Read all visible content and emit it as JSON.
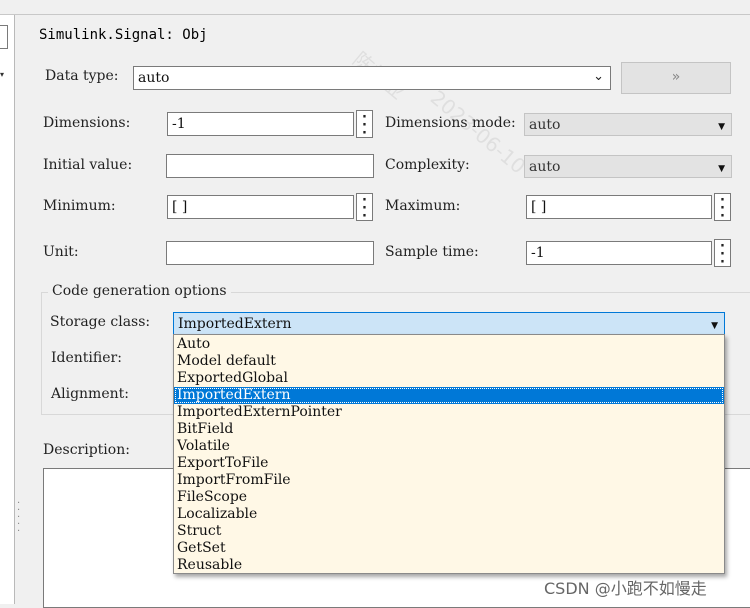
{
  "title": "Simulink.Signal: Obj",
  "data_type": {
    "label": "Data type:",
    "value": "auto",
    "advanced_button": "»"
  },
  "dimensions": {
    "label": "Dimensions:",
    "value": "-1"
  },
  "dimensions_mode": {
    "label": "Dimensions mode:",
    "value": "auto"
  },
  "initial_value": {
    "label": "Initial value:",
    "value": ""
  },
  "complexity": {
    "label": "Complexity:",
    "value": "auto"
  },
  "minimum": {
    "label": "Minimum:",
    "value": "[ ]"
  },
  "maximum": {
    "label": "Maximum:",
    "value": "[ ]"
  },
  "unit": {
    "label": "Unit:",
    "value": ""
  },
  "sample_time": {
    "label": "Sample time:",
    "value": "-1"
  },
  "code_gen": {
    "group_title": "Code generation options",
    "storage_class_label": "Storage class:",
    "storage_class_value": "ImportedExtern",
    "identifier_label": "Identifier:",
    "alignment_label": "Alignment:"
  },
  "description": {
    "label": "Description:"
  },
  "storage_options": [
    "Auto",
    "Model default",
    "ExportedGlobal",
    "ImportedExtern",
    "ImportedExternPointer",
    "BitField",
    "Volatile",
    "ExportToFile",
    "ImportFromFile",
    "FileScope",
    "Localizable",
    "Struct",
    "GetSet",
    "Reusable"
  ],
  "selected_index": 3,
  "watermark": "CSDN @小跑不如慢走",
  "background_watermarks": [
    "陈雄业",
    "2023-06-10"
  ],
  "colors": {
    "selection": "#0078d7",
    "dropdown_bg": "#fff8e6",
    "storage_bg": "#cce4f7"
  }
}
